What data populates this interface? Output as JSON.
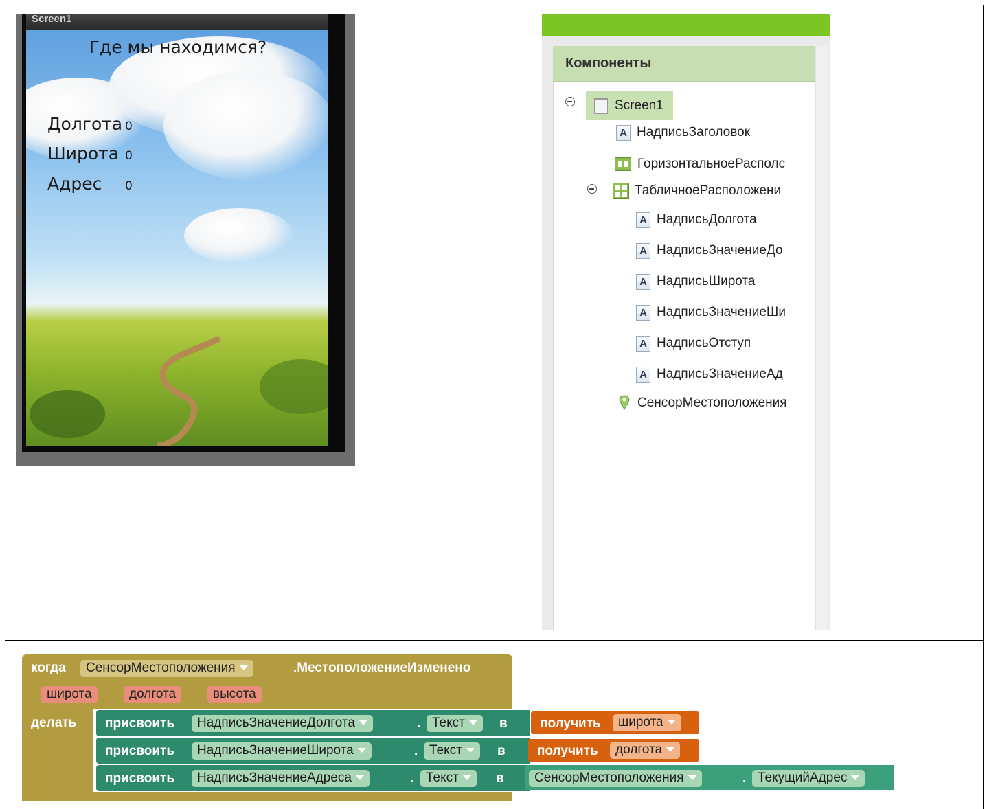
{
  "phone": {
    "screen_name": "Screen1",
    "title": "Где мы находимся?",
    "rows": [
      {
        "label": "Долгота",
        "value": "0"
      },
      {
        "label": "Широта",
        "value": "0"
      },
      {
        "label": "Адрес",
        "value": "0"
      }
    ]
  },
  "components": {
    "header": "Компоненты",
    "tree": [
      {
        "label": "Screen1",
        "icon": "screen-icon",
        "level": 0,
        "expanded": true,
        "selected": true
      },
      {
        "label": "НадписьЗаголовок",
        "icon": "label-icon",
        "level": 1
      },
      {
        "label": "ГоризонтальноеРасполс",
        "icon": "horizontal-arrangement-icon",
        "level": 1
      },
      {
        "label": "ТабличноеРасположени",
        "icon": "table-arrangement-icon",
        "level": 1,
        "expanded": true
      },
      {
        "label": "НадписьДолгота",
        "icon": "label-icon",
        "level": 2
      },
      {
        "label": "НадписьЗначениеДо",
        "icon": "label-icon",
        "level": 2
      },
      {
        "label": "НадписьШирота",
        "icon": "label-icon",
        "level": 2
      },
      {
        "label": "НадписьЗначениеШи",
        "icon": "label-icon",
        "level": 2
      },
      {
        "label": "НадписьОтступ",
        "icon": "label-icon",
        "level": 2
      },
      {
        "label": "НадписьЗначениеАд",
        "icon": "label-icon",
        "level": 2
      },
      {
        "label": "СенсорМестоположения",
        "icon": "location-sensor-icon",
        "level": 1
      }
    ]
  },
  "blocks": {
    "when": "когда",
    "component": "СенсорМестоположения",
    "event": ".МестоположениеИзменено",
    "params": [
      "широта",
      "долгота",
      "высота"
    ],
    "do": "делать",
    "statements": [
      {
        "set": "присвоить",
        "target": "НадписьЗначениеДолгота",
        "dot": ".",
        "prop": "Текст",
        "to": "в",
        "get": "получить",
        "var": "широта"
      },
      {
        "set": "присвоить",
        "target": "НадписьЗначениеШирота",
        "dot": ".",
        "prop": "Текст",
        "to": "в",
        "get": "получить",
        "var": "долгота"
      },
      {
        "set": "присвоить",
        "target": "НадписьЗначениеАдреса",
        "dot": ".",
        "prop": "Текст",
        "to": "в",
        "sensor": "СенсорМестоположения",
        "sensor_prop": "ТекущийАдрес"
      }
    ]
  },
  "colors": {
    "event_block": "#b39c40",
    "set_block": "#2e8a6c",
    "get_block": "#d7610f",
    "sensor_block": "#3ca07d",
    "topbar": "#7cc524",
    "panel_header": "#c6deb1"
  }
}
